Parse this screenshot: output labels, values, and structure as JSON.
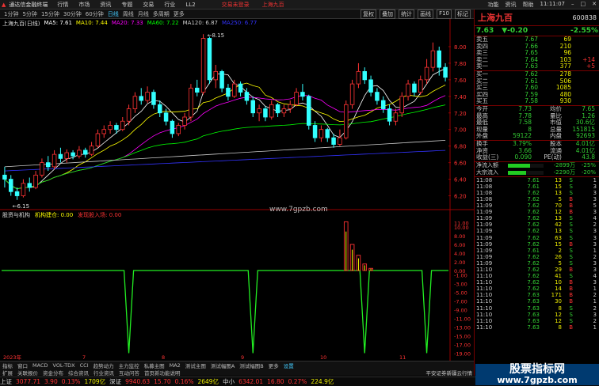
{
  "menubar": {
    "app_title": "通达信金融终端",
    "items": [
      "行情",
      "市场",
      "资讯",
      "专题",
      "交易",
      "行业",
      "LL2"
    ],
    "trade_link": "交易未登录",
    "stock_title": "上海九百",
    "right_items": [
      "功能",
      "资讯",
      "帮助"
    ],
    "clock": "11:11:07"
  },
  "toolbar": {
    "periods": [
      "1分钟",
      "5分钟",
      "15分钟",
      "30分钟",
      "60分钟",
      "日线",
      "周线",
      "月线",
      "多周期",
      "更多"
    ],
    "active_period": "日线",
    "right_buttons": [
      "复权",
      "叠加",
      "统计",
      "画线",
      "F10",
      "标记"
    ]
  },
  "chart": {
    "header": "上海九百(日线)",
    "ma": [
      {
        "label": "MA5: 7.61",
        "color": "#ffffff"
      },
      {
        "label": "MA10: 7.44",
        "color": "#ffff00"
      },
      {
        "label": "MA20: 7.33",
        "color": "#ff00ff"
      },
      {
        "label": "MA60: 7.22",
        "color": "#00ff00"
      },
      {
        "label": "MA120: 6.87",
        "color": "#cccccc"
      },
      {
        "label": "MA250: 6.77",
        "color": "#0000ff"
      }
    ],
    "high_label": "8.15",
    "low_label": "6.15",
    "price_axis": [
      "8.00",
      "7.80",
      "7.60",
      "7.40",
      "7.20",
      "7.00",
      "6.80",
      "6.60",
      "6.40",
      "6.20"
    ],
    "watermark": "www.7gpzb.com",
    "indicator_header": "股资与机构",
    "indicator_items": [
      {
        "label": "机构建仓: 0.00",
        "color": "#ffff00"
      },
      {
        "label": "发现股入场: 0.00",
        "color": "#ff3333"
      }
    ],
    "indicator_axis": [
      "11.00",
      "10.00",
      "8.00",
      "6.00",
      "4.00",
      "2.00",
      "0.00",
      "-1.00",
      "-3.00",
      "-5.00",
      "-7.00",
      "-9.00",
      "-11.00",
      "-13.00",
      "-15.00",
      "-17.00",
      "-19.00"
    ],
    "date_marks": [
      "2023年",
      "7",
      "8",
      "9",
      "10",
      "11"
    ]
  },
  "chart_data": {
    "type": "candlestick",
    "y_range": [
      6.1,
      8.2
    ],
    "candles": [
      [
        6.45,
        6.4,
        6.55,
        6.3
      ],
      [
        6.4,
        6.25,
        6.45,
        6.2
      ],
      [
        6.25,
        6.2,
        6.3,
        6.15
      ],
      [
        6.2,
        6.35,
        6.4,
        6.18
      ],
      [
        6.35,
        6.3,
        6.42,
        6.25
      ],
      [
        6.3,
        6.45,
        6.5,
        6.28
      ],
      [
        6.45,
        6.6,
        6.65,
        6.42
      ],
      [
        6.6,
        6.55,
        6.68,
        6.5
      ],
      [
        6.55,
        6.7,
        6.75,
        6.52
      ],
      [
        6.7,
        6.65,
        6.78,
        6.6
      ],
      [
        6.65,
        6.72,
        6.76,
        6.6
      ],
      [
        6.72,
        6.68,
        6.75,
        6.64
      ],
      [
        6.68,
        6.75,
        6.8,
        6.65
      ],
      [
        6.75,
        6.7,
        6.78,
        6.66
      ],
      [
        6.7,
        6.8,
        6.85,
        6.68
      ],
      [
        6.8,
        6.95,
        7.0,
        6.78
      ],
      [
        6.95,
        7.0,
        7.05,
        6.9
      ],
      [
        7.0,
        7.05,
        7.1,
        6.95
      ],
      [
        7.05,
        7.0,
        7.08,
        6.95
      ],
      [
        7.0,
        7.1,
        7.15,
        6.98
      ],
      [
        7.1,
        7.25,
        7.3,
        7.05
      ],
      [
        7.25,
        7.4,
        7.45,
        7.2
      ],
      [
        7.4,
        7.35,
        7.5,
        7.3
      ],
      [
        7.35,
        7.45,
        7.52,
        7.32
      ],
      [
        7.45,
        7.3,
        7.48,
        7.25
      ],
      [
        7.3,
        7.2,
        7.35,
        7.15
      ],
      [
        7.2,
        7.1,
        7.25,
        7.05
      ],
      [
        7.1,
        6.95,
        7.12,
        6.9
      ],
      [
        6.95,
        7.05,
        7.08,
        6.92
      ],
      [
        7.05,
        7.15,
        7.2,
        7.0
      ],
      [
        7.15,
        7.5,
        7.55,
        7.1
      ],
      [
        7.5,
        7.45,
        7.6,
        7.4
      ],
      [
        7.45,
        8.1,
        8.15,
        7.42
      ],
      [
        8.1,
        7.6,
        8.12,
        7.55
      ],
      [
        7.6,
        7.7,
        7.78,
        7.5
      ],
      [
        7.7,
        7.5,
        7.72,
        7.45
      ],
      [
        7.5,
        7.4,
        7.55,
        7.35
      ],
      [
        7.4,
        7.55,
        7.6,
        7.38
      ],
      [
        7.55,
        7.45,
        7.58,
        7.4
      ],
      [
        7.45,
        7.35,
        7.5,
        7.3
      ],
      [
        7.35,
        7.2,
        7.4,
        7.15
      ],
      [
        7.2,
        7.25,
        7.3,
        7.1
      ],
      [
        7.25,
        7.15,
        7.28,
        7.1
      ],
      [
        7.15,
        7.3,
        7.35,
        7.12
      ],
      [
        7.3,
        7.2,
        7.32,
        7.15
      ],
      [
        7.2,
        7.25,
        7.3,
        7.15
      ],
      [
        7.25,
        7.3,
        7.35,
        7.2
      ],
      [
        7.3,
        7.45,
        7.5,
        7.28
      ],
      [
        7.45,
        7.4,
        7.55,
        7.35
      ],
      [
        7.4,
        7.05,
        7.42,
        7.0
      ],
      [
        7.05,
        6.9,
        7.1,
        6.85
      ],
      [
        6.9,
        7.0,
        7.05,
        6.85
      ],
      [
        7.0,
        6.9,
        7.02,
        6.85
      ],
      [
        6.9,
        6.82,
        6.95,
        6.78
      ],
      [
        6.82,
        6.9,
        7.0,
        6.8
      ],
      [
        6.9,
        7.3,
        7.35,
        6.88
      ],
      [
        7.3,
        7.55,
        7.6,
        7.25
      ],
      [
        7.55,
        7.7,
        7.8,
        7.5
      ],
      [
        7.7,
        7.6,
        7.75,
        7.55
      ],
      [
        7.6,
        7.45,
        7.65,
        7.4
      ],
      [
        7.45,
        7.35,
        7.5,
        7.3
      ],
      [
        7.35,
        7.25,
        7.4,
        7.2
      ],
      [
        7.25,
        7.1,
        7.3,
        7.05
      ],
      [
        7.1,
        7.2,
        7.25,
        7.05
      ],
      [
        7.2,
        7.4,
        7.45,
        7.15
      ],
      [
        7.4,
        7.55,
        7.6,
        7.35
      ],
      [
        7.55,
        7.45,
        7.58,
        7.4
      ],
      [
        7.45,
        7.6,
        7.65,
        7.42
      ],
      [
        7.6,
        7.75,
        7.85,
        7.55
      ],
      [
        7.75,
        7.95,
        8.05,
        7.7
      ],
      [
        7.95,
        7.75,
        8.0,
        7.65
      ],
      [
        7.75,
        7.63,
        7.8,
        7.58
      ]
    ],
    "indicator_red_bars": [
      {
        "index": 55,
        "value": 11.2
      },
      {
        "index": 56,
        "value": 6.0
      },
      {
        "index": 57,
        "value": 3.5
      },
      {
        "index": 58,
        "value": 1.5
      },
      {
        "index": 59,
        "value": 0.5
      }
    ],
    "indicator_green_dips": [
      20,
      40,
      58,
      68
    ],
    "indicator_range": [
      -20,
      12
    ]
  },
  "panel": {
    "stock_name": "上海九百",
    "stock_code": "600838",
    "price": "7.63",
    "change": "▼-0.20",
    "change_pct": "-2.55%",
    "asks": [
      {
        "label": "卖五",
        "price": "7.67",
        "vol": "69",
        "chg": ""
      },
      {
        "label": "卖四",
        "price": "7.66",
        "vol": "210",
        "chg": ""
      },
      {
        "label": "卖三",
        "price": "7.65",
        "vol": "96",
        "chg": ""
      },
      {
        "label": "卖二",
        "price": "7.64",
        "vol": "103",
        "chg": "+14"
      },
      {
        "label": "卖一",
        "price": "7.63",
        "vol": "377",
        "chg": "+5"
      }
    ],
    "bids": [
      {
        "label": "买一",
        "price": "7.62",
        "vol": "278",
        "chg": ""
      },
      {
        "label": "买二",
        "price": "7.61",
        "vol": "506",
        "chg": ""
      },
      {
        "label": "买三",
        "price": "7.60",
        "vol": "1085",
        "chg": ""
      },
      {
        "label": "买四",
        "price": "7.59",
        "vol": "480",
        "chg": ""
      },
      {
        "label": "买五",
        "price": "7.58",
        "vol": "930",
        "chg": ""
      }
    ],
    "stats": [
      [
        "今开",
        "7.73",
        "均价",
        "7.65"
      ],
      [
        "最高",
        "7.78",
        "量比",
        "1.26"
      ],
      [
        "最低",
        "7.58",
        "市值",
        "30.6亿"
      ],
      [
        "现量",
        "8",
        "总量",
        "151815"
      ],
      [
        "外盘",
        "59122",
        "内盘",
        "92693"
      ]
    ],
    "stats2": [
      [
        "换手",
        "3.79%",
        "股本",
        "4.01亿"
      ],
      [
        "净资",
        "3.66",
        "流通",
        "4.01亿"
      ],
      [
        "收益(三)",
        "0.090",
        "PE(动)",
        "43.8"
      ]
    ],
    "flows": [
      {
        "label": "净流入额",
        "value": "-2899万",
        "pct": "-25%",
        "fill": 0.62
      },
      {
        "label": "大宗流入",
        "value": "-2290万",
        "pct": "-20%",
        "fill": 0.5
      }
    ],
    "ticks": [
      [
        "11:08",
        "7.61",
        "13",
        "S",
        "1"
      ],
      [
        "11:08",
        "7.61",
        "15",
        "S",
        "3"
      ],
      [
        "11:08",
        "7.62",
        "13",
        "S",
        "3"
      ],
      [
        "11:08",
        "7.62",
        "5",
        "B",
        "3"
      ],
      [
        "11:09",
        "7.62",
        "70",
        "B",
        "5"
      ],
      [
        "11:09",
        "7.62",
        "12",
        "B",
        "3"
      ],
      [
        "11:09",
        "7.62",
        "13",
        "S",
        "4"
      ],
      [
        "11:09",
        "7.62",
        "42",
        "S",
        "2"
      ],
      [
        "11:09",
        "7.62",
        "13",
        "S",
        "3"
      ],
      [
        "11:09",
        "7.62",
        "63",
        "S",
        "3"
      ],
      [
        "11:09",
        "7.62",
        "15",
        "B",
        "3"
      ],
      [
        "11:09",
        "7.61",
        "2",
        "S",
        "1"
      ],
      [
        "11:09",
        "7.62",
        "26",
        "S",
        "2"
      ],
      [
        "11:09",
        "7.62",
        "5",
        "S",
        "3"
      ],
      [
        "11:10",
        "7.62",
        "29",
        "B",
        "3"
      ],
      [
        "11:10",
        "7.62",
        "41",
        "S",
        "4"
      ],
      [
        "11:10",
        "7.62",
        "10",
        "B",
        "3"
      ],
      [
        "11:10",
        "7.62",
        "14",
        "B",
        "1"
      ],
      [
        "11:10",
        "7.63",
        "171",
        "B",
        "2"
      ],
      [
        "11:10",
        "7.63",
        "30",
        "B",
        "1"
      ],
      [
        "11:10",
        "7.63",
        "8",
        "S",
        "2"
      ],
      [
        "11:10",
        "7.63",
        "12",
        "S",
        "3"
      ],
      [
        "11:10",
        "7.63",
        "12",
        "S",
        "2"
      ],
      [
        "11:10",
        "7.63",
        "8",
        "B",
        "1"
      ]
    ]
  },
  "tabs": [
    "指标",
    "窗口",
    "MACD",
    "VOL-TDX",
    "CCI",
    "趋势动力",
    "主力监控",
    "私募主图",
    "MA2",
    "测试主图",
    "测试幅图A",
    "测试幅图B",
    "更多",
    "设置"
  ],
  "tabs2": [
    "扩展",
    "关联报价",
    "资金分布",
    "综合资讯",
    "行业资讯",
    "互动问答",
    "首页新功能说明"
  ],
  "status": {
    "sh_label": "上证",
    "sh_val": "3077.71",
    "sh_chg": "3.90",
    "sh_pct": "0.13%",
    "sh_amt": "1709亿",
    "sz_label": "深证",
    "sz_val": "9940.63",
    "sz_chg": "15.70",
    "sz_pct": "0.16%",
    "sz_amt": "2649亿",
    "zx_label": "中小",
    "zx_val": "6342.01",
    "zx_chg": "16.80",
    "zx_pct": "0.27%",
    "zx_amt": "224.9亿",
    "right_text": "平安证券新疆云行情"
  },
  "ad": {
    "line1": "股票指标网",
    "line2": "www.7gpzb.com"
  }
}
